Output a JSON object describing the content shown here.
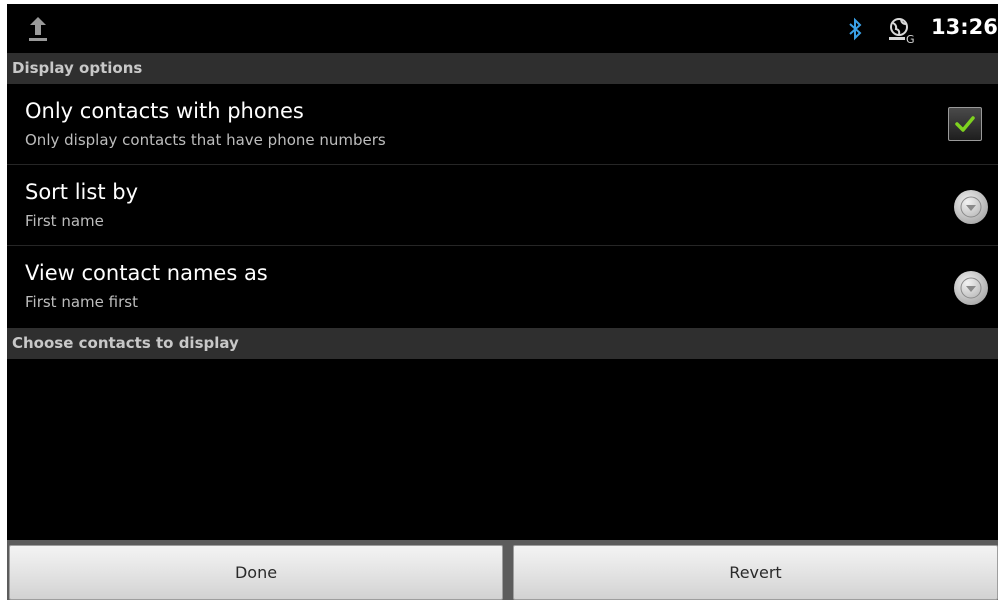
{
  "status_bar": {
    "time": "13:26",
    "icons": [
      "upload-icon",
      "bluetooth-icon",
      "sync-icon"
    ]
  },
  "sections": {
    "display_options": "Display options",
    "choose_contacts": "Choose contacts to display"
  },
  "preferences": {
    "only_phones": {
      "title": "Only contacts with phones",
      "summary": "Only display contacts that have phone numbers",
      "checked": true
    },
    "sort_list": {
      "title": "Sort list by",
      "summary": "First name"
    },
    "view_names": {
      "title": "View contact names as",
      "summary": "First name first"
    }
  },
  "buttons": {
    "done": "Done",
    "revert": "Revert"
  },
  "colors": {
    "checkmark": "#7ed21f",
    "bluetooth": "#3aa0e6",
    "category_bg": "#2f2f2f",
    "background": "#000000"
  }
}
